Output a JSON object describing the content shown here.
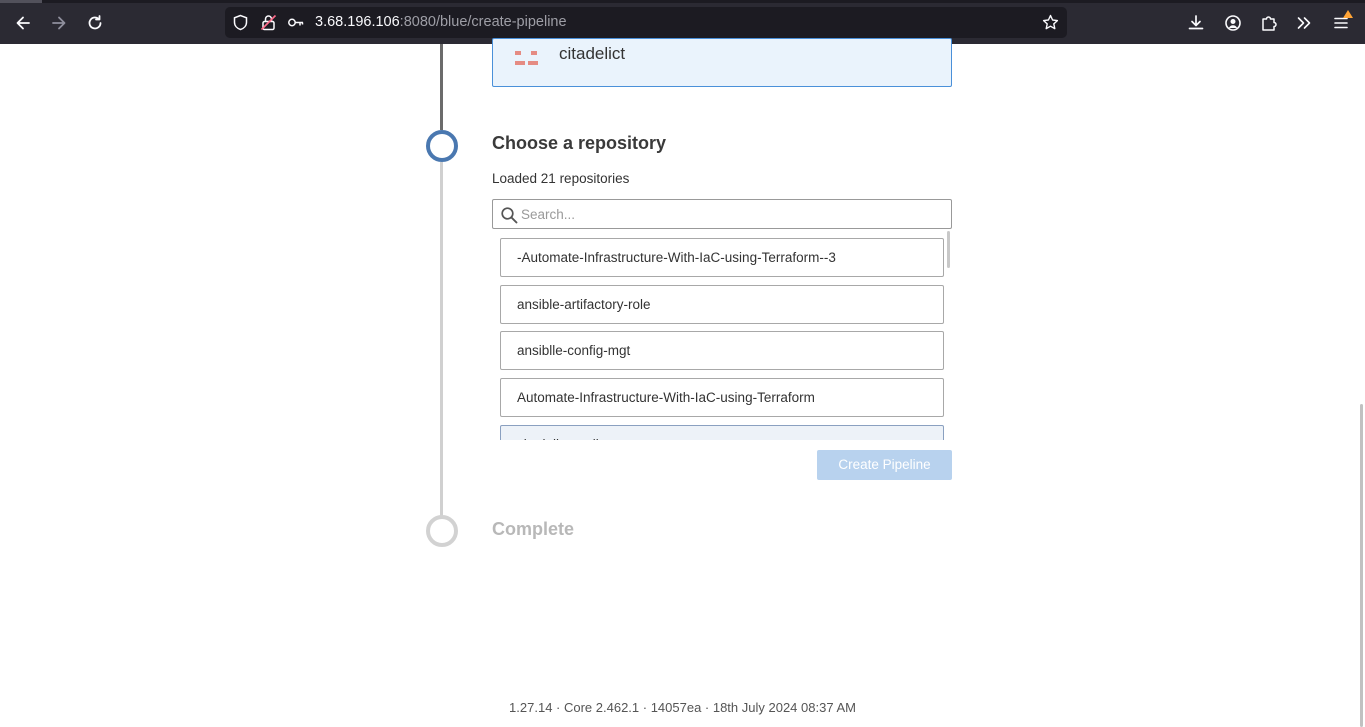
{
  "browser": {
    "url_host": "3.68.196.106",
    "url_path": ":8080/blue/create-pipeline",
    "icons": {
      "back": "arrow-left-icon",
      "forward": "arrow-right-icon",
      "reload": "reload-icon",
      "shield": "shield-icon",
      "lock": "lock-warning-icon",
      "key": "key-icon",
      "bookmark": "star-icon",
      "downloads": "download-icon",
      "account": "account-icon",
      "extensions": "puzzle-icon",
      "overflow": "double-chevron-icon",
      "menu": "hamburger-menu-icon"
    },
    "colors": {
      "toolbar": "#2b2a33",
      "urlbar": "#1c1b22",
      "notification": "#ffa436"
    }
  },
  "organization": {
    "name": "citadelict"
  },
  "repository_step": {
    "title": "Choose a repository",
    "subtitle": "Loaded 21 repositories",
    "search_placeholder": "Search...",
    "repositories": [
      "-Automate-Infrastructure-With-IaC-using-Terraform--3",
      "ansible-artifactory-role",
      "ansiblle-config-mgt",
      "Automate-Infrastructure-With-IaC-using-Terraform",
      "citadelict-tooling-repo"
    ],
    "create_button": "Create Pipeline"
  },
  "complete_step": {
    "title": "Complete"
  },
  "footer": {
    "version": "1.27.14 · Core 2.462.1 · 14057ea · 18th July 2024 08:37 AM"
  },
  "colors": {
    "active_step": "#4a78b0",
    "pending_step": "#d2d2d2",
    "selected_card_bg": "#eaf3fc",
    "selected_card_border": "#4a90d9",
    "button_disabled": "#b8d2ee"
  }
}
